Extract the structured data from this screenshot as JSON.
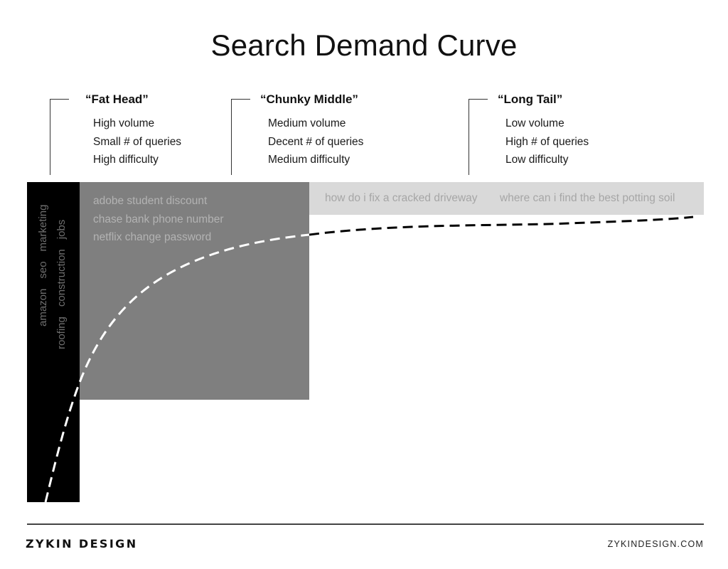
{
  "title": "Search Demand Curve",
  "segments": [
    {
      "name": "“Fat Head”",
      "traits": [
        "High volume",
        "Small # of queries",
        "High difficulty"
      ]
    },
    {
      "name": "“Chunky Middle”",
      "traits": [
        "Medium volume",
        "Decent # of queries",
        "Medium difficulty"
      ]
    },
    {
      "name": "“Long Tail”",
      "traits": [
        "Low volume",
        "High # of queries",
        "Low difficulty"
      ]
    }
  ],
  "head_terms": {
    "row1": [
      "amazon",
      "seo",
      "marketing"
    ],
    "row2": [
      "roofing",
      "construction",
      "jobs"
    ]
  },
  "middle_queries": [
    "adobe student discount",
    "chase bank phone number",
    "netflix change password"
  ],
  "tail_queries": [
    "how do i fix a cracked driveway",
    "where can i find the best potting soil"
  ],
  "colors": {
    "fat_head": "#000000",
    "chunky_middle": "#7f7f7f",
    "long_tail": "#d9d9d9",
    "curve_on_dark": "#ffffff",
    "curve_on_light": "#000000"
  },
  "footer": {
    "brand": "ZYKIN DESIGN",
    "website": "ZYKINDESIGN.COM"
  }
}
